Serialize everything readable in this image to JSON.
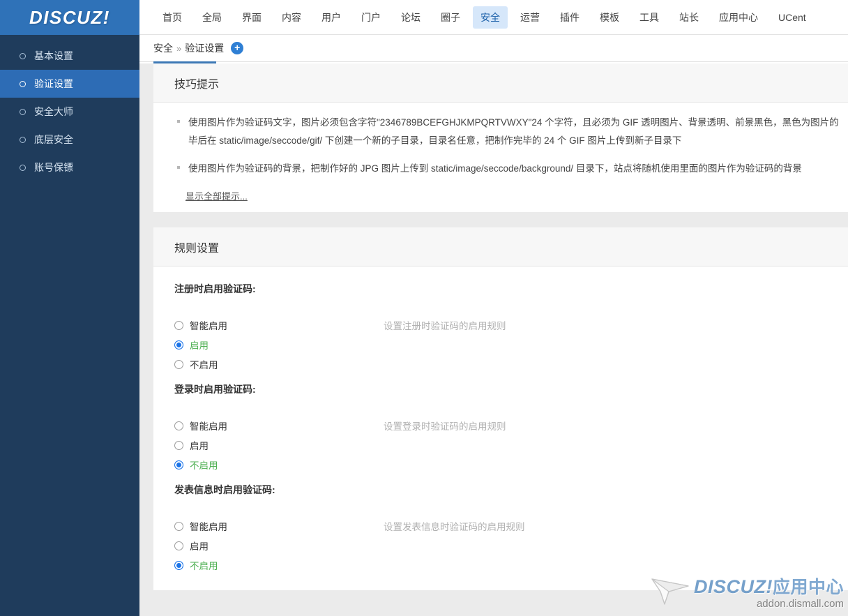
{
  "brand": {
    "logo_text": "DISCUZ!"
  },
  "topnav": {
    "items": [
      {
        "label": "首页",
        "active": false
      },
      {
        "label": "全局",
        "active": false
      },
      {
        "label": "界面",
        "active": false
      },
      {
        "label": "内容",
        "active": false
      },
      {
        "label": "用户",
        "active": false
      },
      {
        "label": "门户",
        "active": false
      },
      {
        "label": "论坛",
        "active": false
      },
      {
        "label": "圈子",
        "active": false
      },
      {
        "label": "安全",
        "active": true
      },
      {
        "label": "运营",
        "active": false
      },
      {
        "label": "插件",
        "active": false
      },
      {
        "label": "模板",
        "active": false
      },
      {
        "label": "工具",
        "active": false
      },
      {
        "label": "站长",
        "active": false
      },
      {
        "label": "应用中心",
        "active": false
      },
      {
        "label": "UCent",
        "active": false
      }
    ]
  },
  "sidebar": {
    "items": [
      {
        "label": "基本设置",
        "active": false
      },
      {
        "label": "验证设置",
        "active": true
      },
      {
        "label": "安全大师",
        "active": false
      },
      {
        "label": "底层安全",
        "active": false
      },
      {
        "label": "账号保镖",
        "active": false
      }
    ]
  },
  "breadcrumb": {
    "root": "安全",
    "separator": "»",
    "current": "验证设置",
    "add_label": "+"
  },
  "tips_panel": {
    "title": "技巧提示",
    "items": [
      "使用图片作为验证码文字，图片必须包含字符\"2346789BCEFGHJKMPQRTVWXY\"24 个字符，且必须为 GIF 透明图片、背景透明、前景黑色，黑色为图片的毕后在 static/image/seccode/gif/ 下创建一个新的子目录，目录名任意，把制作完毕的 24 个 GIF 图片上传到新子目录下",
      "使用图片作为验证码的背景，把制作好的 JPG 图片上传到 static/image/seccode/background/ 目录下，站点将随机使用里面的图片作为验证码的背景"
    ],
    "items_lines": [
      [
        "使用图片作为验证码文字，图片必须包含字符\"2346789BCEFGHJKMPQRTVWXY\"24 个字符，且必须为 GIF 透明图片、背景透明、前景黑色，黑色为图片的",
        "毕后在 static/image/seccode/gif/ 下创建一个新的子目录，目录名任意，把制作完毕的 24 个 GIF 图片上传到新子目录下"
      ],
      [
        "使用图片作为验证码的背景，把制作好的 JPG 图片上传到 static/image/seccode/background/ 目录下，站点将随机使用里面的图片作为验证码的背景"
      ]
    ],
    "show_all_label": "显示全部提示..."
  },
  "rules_panel": {
    "title": "规则设置",
    "fields": [
      {
        "label": "注册时启用验证码:",
        "description": "设置注册时验证码的启用规则",
        "options": [
          {
            "label": "智能启用",
            "checked": false
          },
          {
            "label": "启用",
            "checked": true
          },
          {
            "label": "不启用",
            "checked": false
          }
        ]
      },
      {
        "label": "登录时启用验证码:",
        "description": "设置登录时验证码的启用规则",
        "options": [
          {
            "label": "智能启用",
            "checked": false
          },
          {
            "label": "启用",
            "checked": false
          },
          {
            "label": "不启用",
            "checked": true
          }
        ]
      },
      {
        "label": "发表信息时启用验证码:",
        "description": "设置发表信息时验证码的启用规则",
        "options": [
          {
            "label": "智能启用",
            "checked": false
          },
          {
            "label": "启用",
            "checked": false
          },
          {
            "label": "不启用",
            "checked": true
          }
        ]
      }
    ]
  },
  "watermark": {
    "brand": "DISCUZ!",
    "suffix": "应用中心",
    "url": "addon.dismall.com"
  },
  "colors": {
    "logo_band": "#2f72b8",
    "sidebar_bg": "#1f3c5c",
    "sidebar_active": "#2d6cb5",
    "nav_active_bg": "#d6e7fa",
    "nav_active_text": "#1a5fa8",
    "radio_checked": "#1a73e8",
    "radio_checked_label": "#4caf50",
    "content_bg": "#ebebeb",
    "tab_underline": "#3d78b5"
  }
}
